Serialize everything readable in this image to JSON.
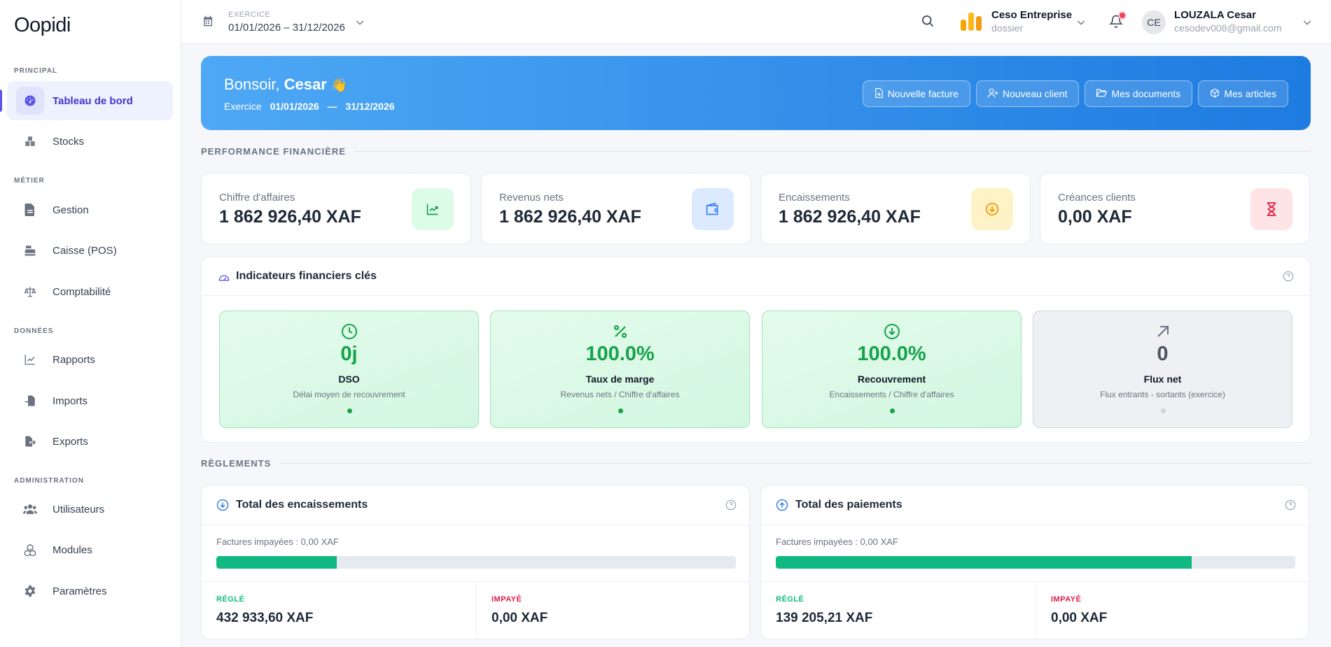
{
  "app": {
    "logo": "Oopidi"
  },
  "colors": {
    "accent": "#5b54e8",
    "banner_start": "#4ea8f5",
    "banner_end": "#1e7be0",
    "success": "#10b981",
    "danger": "#e11d48"
  },
  "sidebar": {
    "sections": [
      {
        "title": "PRINCIPAL",
        "items": [
          {
            "label": "Tableau de bord",
            "icon": "dashboard-icon",
            "active": true
          },
          {
            "label": "Stocks",
            "icon": "boxes-icon"
          }
        ]
      },
      {
        "title": "MÉTIER",
        "items": [
          {
            "label": "Gestion",
            "icon": "document-icon"
          },
          {
            "label": "Caisse (POS)",
            "icon": "cash-register-icon"
          },
          {
            "label": "Comptabilité",
            "icon": "scale-icon"
          }
        ]
      },
      {
        "title": "DONNÉES",
        "items": [
          {
            "label": "Rapports",
            "icon": "line-chart-icon"
          },
          {
            "label": "Imports",
            "icon": "import-icon"
          },
          {
            "label": "Exports",
            "icon": "export-icon"
          }
        ]
      },
      {
        "title": "ADMINISTRATION",
        "items": [
          {
            "label": "Utilisateurs",
            "icon": "users-icon"
          },
          {
            "label": "Modules",
            "icon": "cubes-icon"
          },
          {
            "label": "Paramètres",
            "icon": "gear-icon"
          }
        ]
      }
    ]
  },
  "topbar": {
    "exercise_label": "EXERCICE",
    "exercise_value": "01/01/2026 – 31/12/2026",
    "company_name": "Ceso Entreprise",
    "company_sub": "dossier",
    "user_initials": "CE",
    "user_name": "LOUZALA Cesar",
    "user_email": "cesodev008@gmail.com"
  },
  "banner": {
    "greeting": "Bonsoir,",
    "name": "Cesar",
    "emoji": "👋",
    "exercise_label": "Exercice",
    "start": "01/01/2026",
    "sep": "—",
    "end": "31/12/2026",
    "buttons": [
      {
        "label": "Nouvelle facture",
        "icon": "file-plus-icon"
      },
      {
        "label": "Nouveau client",
        "icon": "user-plus-icon"
      },
      {
        "label": "Mes documents",
        "icon": "folder-open-icon"
      },
      {
        "label": "Mes articles",
        "icon": "box-icon"
      }
    ]
  },
  "performance": {
    "title": "PERFORMANCE FINANCIÈRE",
    "kpis": [
      {
        "label": "Chiffre d'affaires",
        "value": "1 862 926,40 XAF",
        "icon": "trending-up-icon",
        "bg": "#dcfce7",
        "fg": "#16a34a"
      },
      {
        "label": "Revenus nets",
        "value": "1 862 926,40 XAF",
        "icon": "wallet-icon",
        "bg": "#dbeafe",
        "fg": "#3b82f6"
      },
      {
        "label": "Encaissements",
        "value": "1 862 926,40 XAF",
        "icon": "arrow-down-circle-icon",
        "bg": "#fef3c7",
        "fg": "#f59e0b"
      },
      {
        "label": "Créances clients",
        "value": "0,00 XAF",
        "icon": "hourglass-icon",
        "bg": "#ffe4e6",
        "fg": "#e11d48"
      }
    ]
  },
  "indicators": {
    "title": "Indicateurs financiers clés",
    "cards": [
      {
        "value": "0j",
        "name": "DSO",
        "desc": "Délai moyen de recouvrement",
        "icon": "clock-icon",
        "tone": "green"
      },
      {
        "value": "100.0%",
        "name": "Taux de marge",
        "desc": "Revenus nets / Chiffre d'affaires",
        "icon": "percent-icon",
        "tone": "green"
      },
      {
        "value": "100.0%",
        "name": "Recouvrement",
        "desc": "Encaissements / Chiffre d'affaires",
        "icon": "arrow-down-circle-icon",
        "tone": "green"
      },
      {
        "value": "0",
        "name": "Flux net",
        "desc": "Flux entrants - sortants (exercice)",
        "icon": "arrow-up-right-icon",
        "tone": "gray"
      }
    ]
  },
  "reglements": {
    "title": "RÈGLEMENTS",
    "panels": [
      {
        "title": "Total des encaissements",
        "icon": "arrow-down-circle-icon",
        "unpaid": "Factures impayées : 0,00 XAF",
        "progress": 0.232,
        "settled_label": "RÉGLÉ",
        "settled": "432 933,60 XAF",
        "unpaid_label": "IMPAYÉ",
        "unpaid_value": "0,00 XAF"
      },
      {
        "title": "Total des paiements",
        "icon": "arrow-up-circle-icon",
        "unpaid": "Factures impayées : 0,00 XAF",
        "progress": 0.8,
        "settled_label": "RÉGLÉ",
        "settled": "139 205,21 XAF",
        "unpaid_label": "IMPAYÉ",
        "unpaid_value": "0,00 XAF"
      }
    ]
  }
}
